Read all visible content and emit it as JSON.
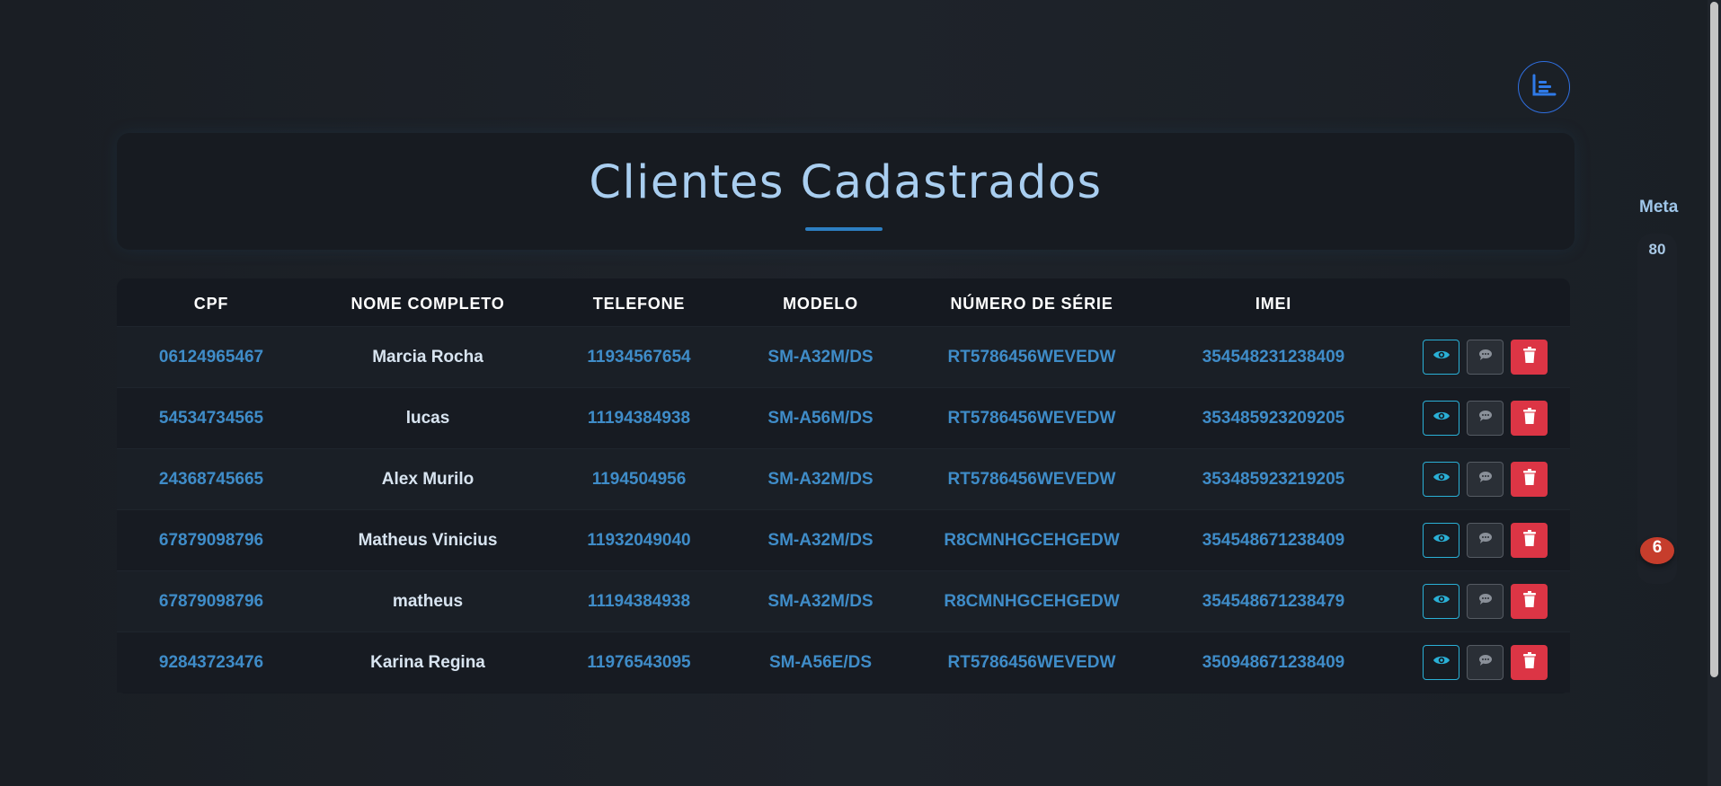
{
  "header": {
    "title": "Clientes Cadastrados",
    "menu_icon": "list-chart-icon"
  },
  "table": {
    "columns": [
      "CPF",
      "NOME COMPLETO",
      "TELEFONE",
      "MODELO",
      "NÚMERO DE SÉRIE",
      "IMEI"
    ],
    "rows": [
      {
        "cpf": "06124965467",
        "nome": "Marcia Rocha",
        "telefone": "11934567654",
        "modelo": "SM-A32M/DS",
        "serie": "RT5786456WEVEDW",
        "imei": "354548231238409"
      },
      {
        "cpf": "54534734565",
        "nome": "lucas",
        "telefone": "11194384938",
        "modelo": "SM-A56M/DS",
        "serie": "RT5786456WEVEDW",
        "imei": "353485923209205"
      },
      {
        "cpf": "24368745665",
        "nome": "Alex Murilo",
        "telefone": "1194504956",
        "modelo": "SM-A32M/DS",
        "serie": "RT5786456WEVEDW",
        "imei": "353485923219205"
      },
      {
        "cpf": "67879098796",
        "nome": "Matheus Vinicius",
        "telefone": "11932049040",
        "modelo": "SM-A32M/DS",
        "serie": "R8CMNHGCEHGEDW",
        "imei": "354548671238409"
      },
      {
        "cpf": "67879098796",
        "nome": "matheus",
        "telefone": "11194384938",
        "modelo": "SM-A32M/DS",
        "serie": "R8CMNHGCEHGEDW",
        "imei": "354548671238479"
      },
      {
        "cpf": "92843723476",
        "nome": "Karina Regina",
        "telefone": "11976543095",
        "modelo": "SM-A56E/DS",
        "serie": "RT5786456WEVEDW",
        "imei": "350948671238409"
      }
    ],
    "action_icons": [
      "eye-icon",
      "comment-icon",
      "trash-icon"
    ]
  },
  "meta": {
    "label": "Meta",
    "max": "80",
    "current": "6"
  },
  "colors": {
    "accent": "#2d7fc2",
    "value_text": "#3f8cc8",
    "danger": "#dc3545",
    "view_border": "#2ab0d6"
  }
}
